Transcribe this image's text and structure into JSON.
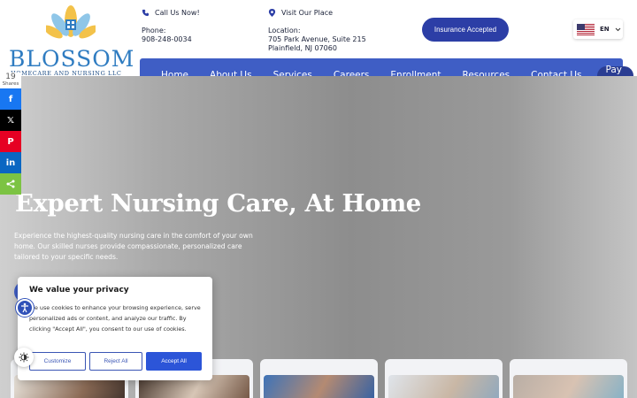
{
  "brand": {
    "name": "BLOSSOM",
    "tagline": "HOMECARE AND NURSING LLC",
    "colors": {
      "primary": "#3f5ec5",
      "dark": "#2a3d92",
      "accent": "#2f7cc1"
    }
  },
  "header": {
    "call": {
      "heading": "Call Us Now!",
      "label": "Phone:",
      "value": "908-248-0034",
      "icon": "phone-icon"
    },
    "visit": {
      "heading": "Visit Our Place",
      "label": "Location:",
      "line1": "705 Park Avenue, Suite 215",
      "line2": "Plainfield, NJ 07060",
      "icon": "map-pin-icon"
    },
    "insurance_button": "Insurance Accepted",
    "language": {
      "selected": "EN",
      "flag": "us-flag-icon"
    }
  },
  "nav": {
    "items": [
      {
        "label": "Home",
        "active": true
      },
      {
        "label": "About Us"
      },
      {
        "label": "Services"
      },
      {
        "label": "Careers"
      },
      {
        "label": "Enrollment"
      },
      {
        "label": "Resources"
      },
      {
        "label": "Contact Us"
      }
    ],
    "pay_button": "Pay Now"
  },
  "social": {
    "count": "19",
    "count_label": "Shares",
    "networks": [
      {
        "name": "facebook",
        "glyph": "f",
        "color": "#1877f2"
      },
      {
        "name": "x",
        "glyph": "𝕏",
        "color": "#000000"
      },
      {
        "name": "pinterest",
        "glyph": "P",
        "color": "#e60023"
      },
      {
        "name": "linkedin",
        "glyph": "in",
        "color": "#0a66c2"
      },
      {
        "name": "share",
        "glyph": "<",
        "color": "#7cc343"
      }
    ]
  },
  "hero": {
    "title": "Expert Nursing Care, At Home",
    "description": "Experience the highest-quality nursing care in the comfort of your own home. Our skilled nurses provide compassionate, personalized care tailored to your specific needs."
  },
  "cookie": {
    "title": "We value your privacy",
    "body": "We use cookies to enhance your browsing experience, serve personalized ads or content, and analyze our traffic. By clicking \"Accept All\", you consent to our use of cookies.",
    "customize": "Customize",
    "reject": "Reject All",
    "accept": "Accept All"
  }
}
